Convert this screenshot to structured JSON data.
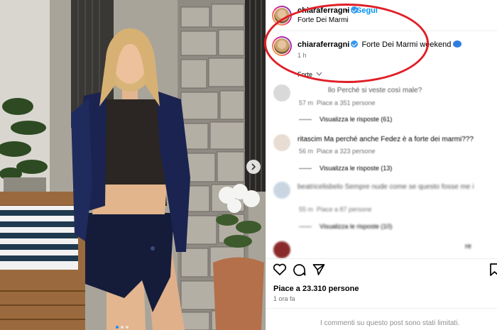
{
  "post": {
    "username": "chiaraferragni",
    "follow_label": "Segui",
    "separator": "•",
    "location": "Forte Dei Marmi",
    "caption_user": "chiaraferragni",
    "caption_text": "Forte Dei Marmi weekend",
    "caption_time": "1 h",
    "lang_label": "Forte",
    "likes": "Piace a 23.310 persone",
    "ago": "1 ora fa",
    "comments_limited": "I commenti su questo post sono stati limitati."
  },
  "comments": [
    {
      "name": "llo Perché si veste così male?",
      "time": "57 m",
      "likes": "Piace a 351 persone",
      "replies": "Visualizza le risposte (61)"
    },
    {
      "name": "ritascim Ma perché anche Fedez è a forte dei marmi???",
      "time": "56 m",
      "likes": "Piace a 323 persone",
      "replies": "Visualizza le risposte (13)"
    },
    {
      "name": "beatricelisbelo Sempre nude come se questo fosse me i",
      "time": "55 m",
      "likes": "Piace a 87 persone",
      "replies": "Visualizza le risposte (10)"
    },
    {
      "name": "re",
      "time": "",
      "likes": "",
      "replies": ""
    }
  ],
  "icons": {
    "heart": "heart-icon",
    "comment": "comment-icon",
    "share": "send-icon",
    "save": "bookmark-icon",
    "next": "chevron-right-icon"
  },
  "colors": {
    "accent": "#0095f6",
    "annotation": "#e01e26",
    "verified": "#3897f0",
    "muted": "#737373"
  }
}
